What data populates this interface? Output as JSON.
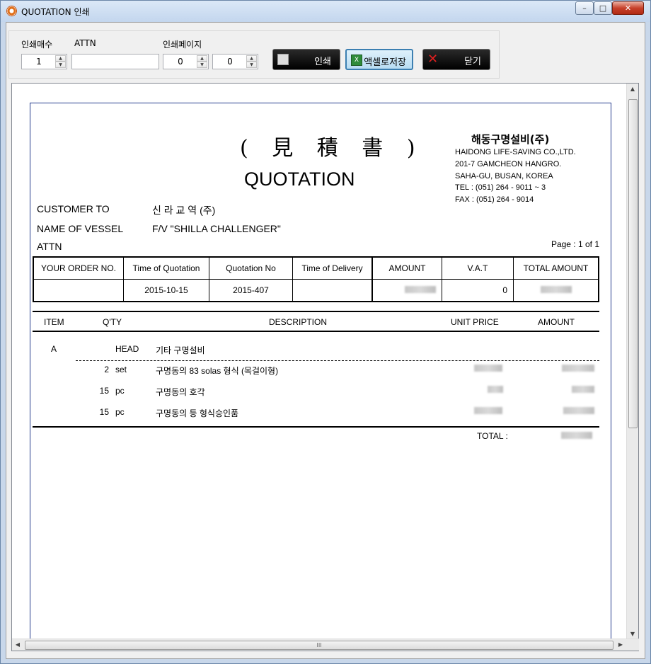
{
  "window": {
    "title": "QUOTATION 인쇄",
    "min": "–",
    "max": "□",
    "close": "✕"
  },
  "toolbar": {
    "copies_label": "인쇄매수",
    "copies_value": "1",
    "attn_label": "ATTN",
    "attn_value": "",
    "pages_label": "인쇄페이지",
    "page_from": "0",
    "page_to": "0",
    "print_label": "인쇄",
    "excel_label": "액셀로저장",
    "close_label": "닫기"
  },
  "doc": {
    "title_cjk": "( 見 積 書 )",
    "title_en": "QUOTATION",
    "company": {
      "name": "해동구명설비(주)",
      "line1": "HAIDONG LIFE-SAVING CO.,LTD.",
      "line2": "201-7 GAMCHEON HANGRO.",
      "line3": "SAHA-GU, BUSAN, KOREA",
      "tel": "TEL : (051) 264 - 9011 ~ 3",
      "fax": "FAX : (051) 264 - 9014"
    },
    "customer_label": "CUSTOMER TO",
    "customer_value": "신 라 교 역 (주)",
    "vessel_label": "NAME OF VESSEL",
    "vessel_value": "F/V \"SHILLA CHALLENGER\"",
    "attn_label": "ATTN",
    "page_indicator": "Page : 1 of 1",
    "summary": {
      "headers": [
        "YOUR ORDER NO.",
        "Time of Quotation",
        "Quotation No",
        "Time of Delivery",
        "AMOUNT",
        "V.A.T",
        "TOTAL AMOUNT"
      ],
      "values": [
        "",
        "2015-10-15",
        "2015-407",
        "",
        "",
        "0",
        ""
      ]
    },
    "items_header": {
      "item": "ITEM",
      "qty": "Q'TY",
      "desc": "DESCRIPTION",
      "unit": "UNIT PRICE",
      "amount": "AMOUNT"
    },
    "group": {
      "code": "A",
      "unit": "HEAD",
      "desc": "기타 구명설비"
    },
    "items": [
      {
        "qty": "2",
        "unit": "set",
        "desc": "구명동의 83 solas 형식 (목걸이형)"
      },
      {
        "qty": "15",
        "unit": "pc",
        "desc": "구명동의 호각"
      },
      {
        "qty": "15",
        "unit": "pc",
        "desc": "구명동의 등 형식승인품"
      }
    ],
    "total_label": "TOTAL :"
  },
  "hscroll_grip": "III"
}
